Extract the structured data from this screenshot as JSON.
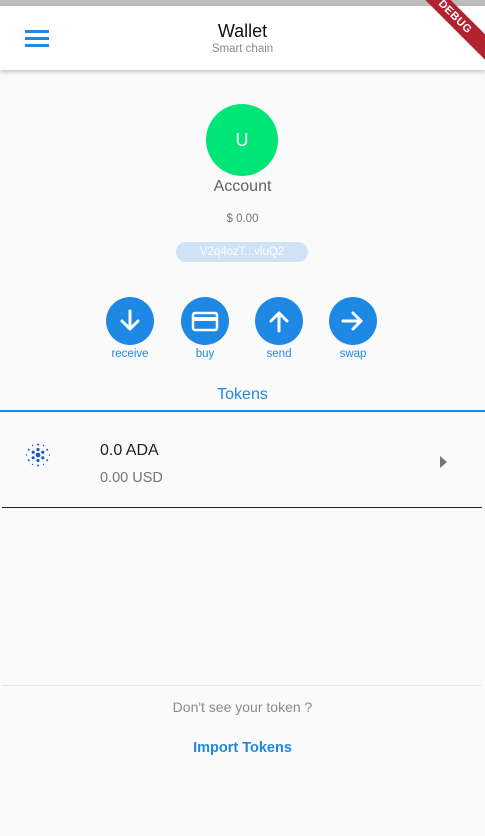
{
  "app": {
    "title": "Wallet",
    "subtitle": "Smart chain",
    "debug_banner": "DEBUG"
  },
  "account": {
    "avatar_letter": "U",
    "name": "Account",
    "balance": "$ 0.00",
    "address_short": "V2q4ozT...vluQ2"
  },
  "actions": [
    {
      "label": "receive",
      "icon": "arrow-down-icon"
    },
    {
      "label": "buy",
      "icon": "credit-card-icon"
    },
    {
      "label": "send",
      "icon": "arrow-up-icon"
    },
    {
      "label": "swap",
      "icon": "arrow-right-icon"
    }
  ],
  "tabs": {
    "tokens": "Tokens"
  },
  "tokens": [
    {
      "amount": "0.0 ADA",
      "fiat": "0.00 USD",
      "icon": "cardano-icon"
    }
  ],
  "footer": {
    "hint": "Don't see your token ?",
    "import_label": "Import Tokens"
  },
  "colors": {
    "accent": "#1e88e5",
    "avatar": "#00e676",
    "address_pill": "#cfe2f6",
    "debug": "#b2222f"
  }
}
